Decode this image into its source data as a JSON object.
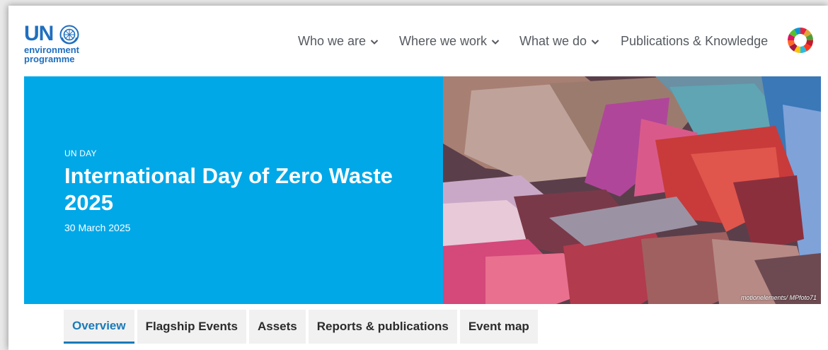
{
  "logo": {
    "un": "UN",
    "line1": "environment",
    "line2": "programme"
  },
  "nav": {
    "items": [
      {
        "label": "Who we are",
        "has_dropdown": true
      },
      {
        "label": "Where we work",
        "has_dropdown": true
      },
      {
        "label": "What we do",
        "has_dropdown": true
      },
      {
        "label": "Publications & Knowledge",
        "has_dropdown": false
      }
    ],
    "sdg_icon": "sdg-wheel-icon"
  },
  "hero": {
    "eyebrow": "UN DAY",
    "title": "International Day of Zero Waste 2025",
    "date": "30 March 2025",
    "image_credit": "motionelements/ MPfoto71",
    "background_color": "#00a8e8"
  },
  "tabs": [
    {
      "label": "Overview",
      "active": true
    },
    {
      "label": "Flagship Events",
      "active": false
    },
    {
      "label": "Assets",
      "active": false
    },
    {
      "label": "Reports & publications",
      "active": false
    },
    {
      "label": "Event map",
      "active": false
    }
  ],
  "colors": {
    "brand_blue": "#1f6fbf",
    "hero_blue": "#00a8e8",
    "tab_active": "#1a7ab8",
    "nav_text": "#555a60"
  }
}
